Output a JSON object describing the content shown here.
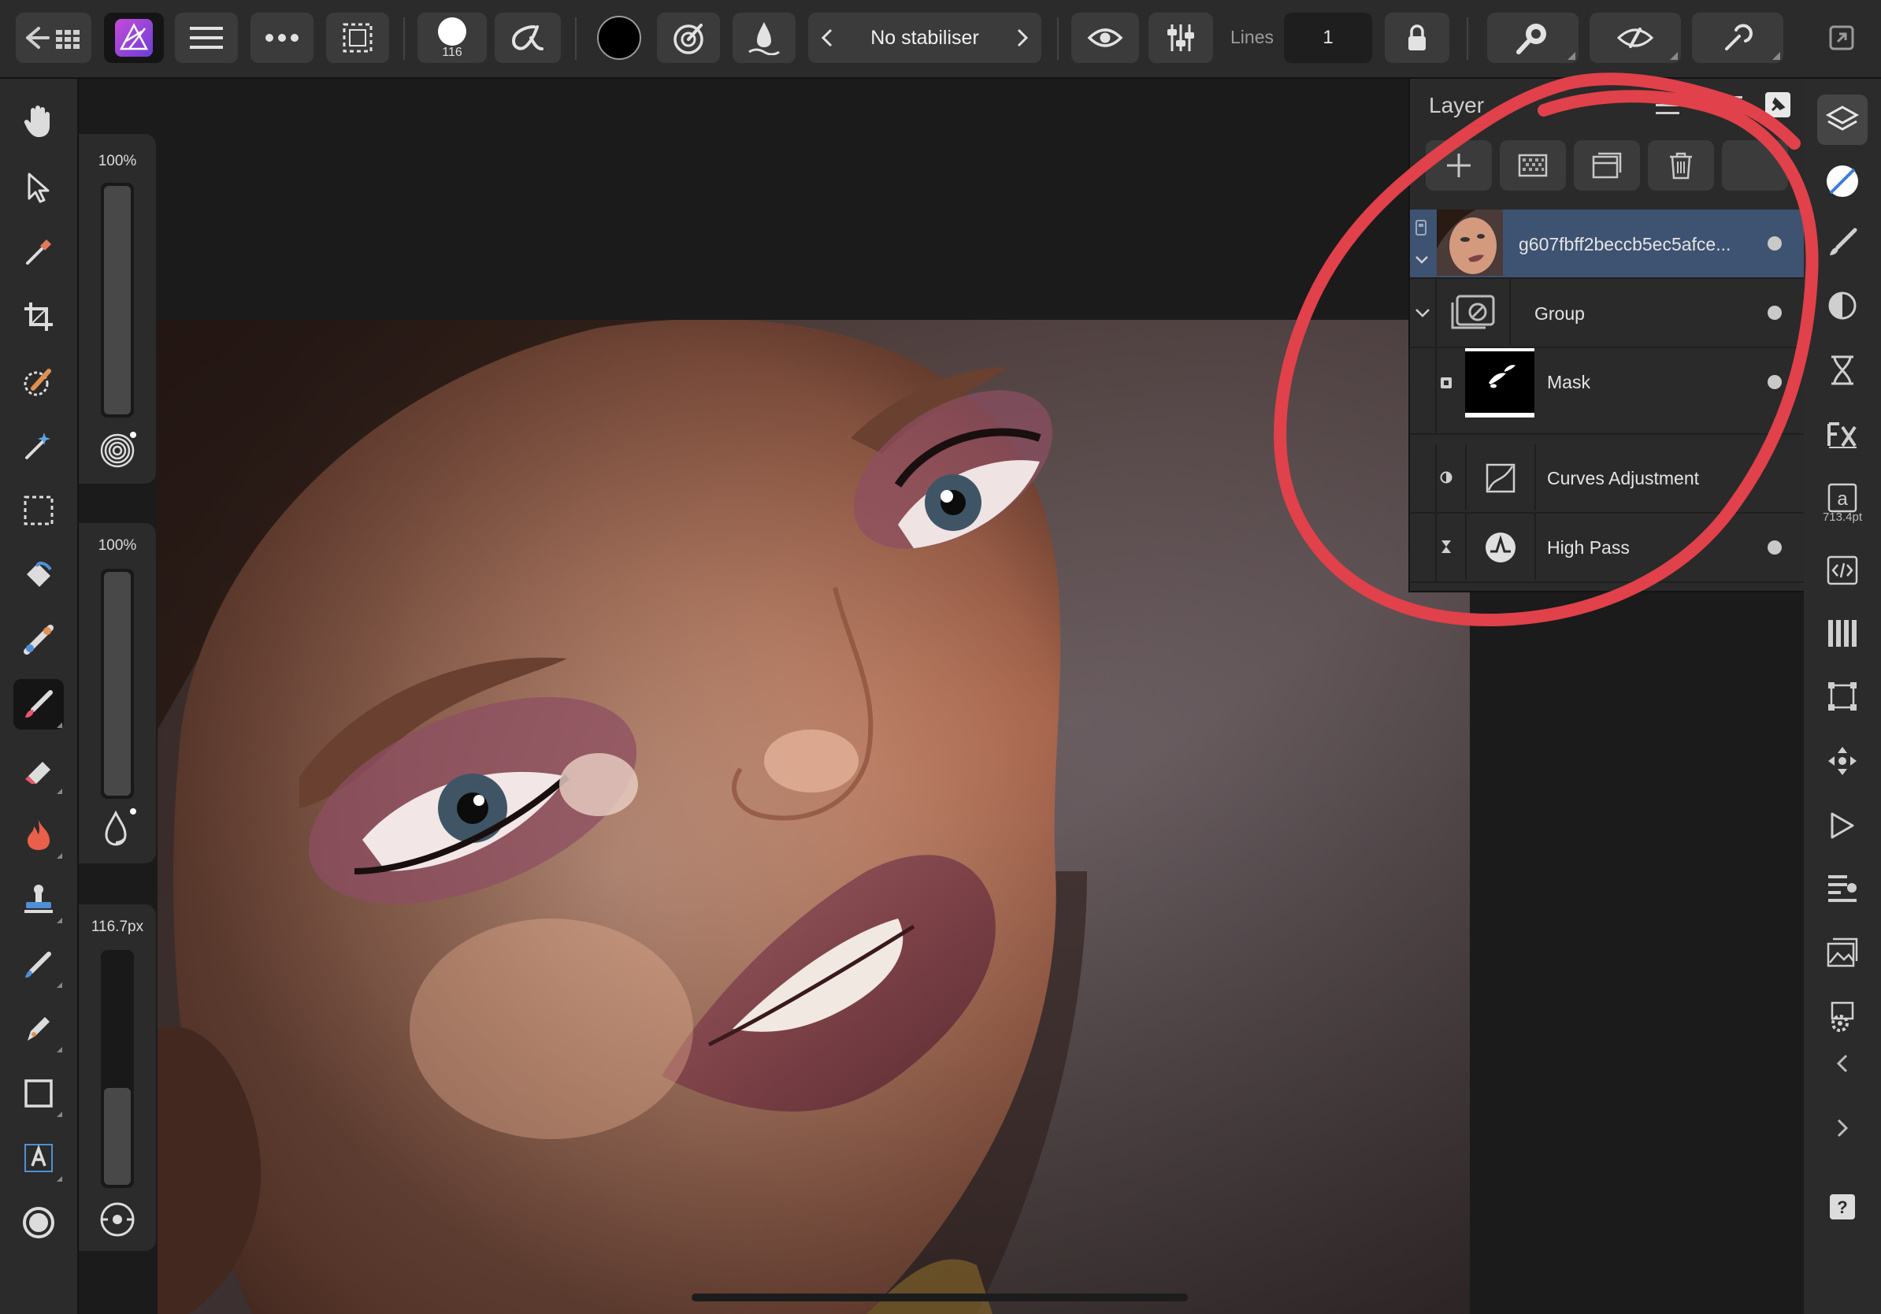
{
  "toolbar": {
    "brush_size": "116",
    "stabiliser_label": "No stabiliser",
    "lines_label": "Lines",
    "lines_value": "1",
    "colors": {
      "primary": "#000000"
    }
  },
  "sliders": {
    "opacity": {
      "label": "100%",
      "level": 1.0
    },
    "flow": {
      "label": "100%",
      "level": 1.0
    },
    "width": {
      "label": "116.7px",
      "level": 0.42
    }
  },
  "layers_panel": {
    "title": "Layer",
    "layers": [
      {
        "name": "g607fbff2beccb5ec5afce...",
        "selected": true
      },
      {
        "name": "Group"
      },
      {
        "name": "Mask"
      },
      {
        "name": "Curves Adjustment"
      },
      {
        "name": "High Pass"
      }
    ]
  },
  "studio": {
    "text_size": "713.4pt"
  },
  "annotation": {
    "color": "#e0414a"
  }
}
